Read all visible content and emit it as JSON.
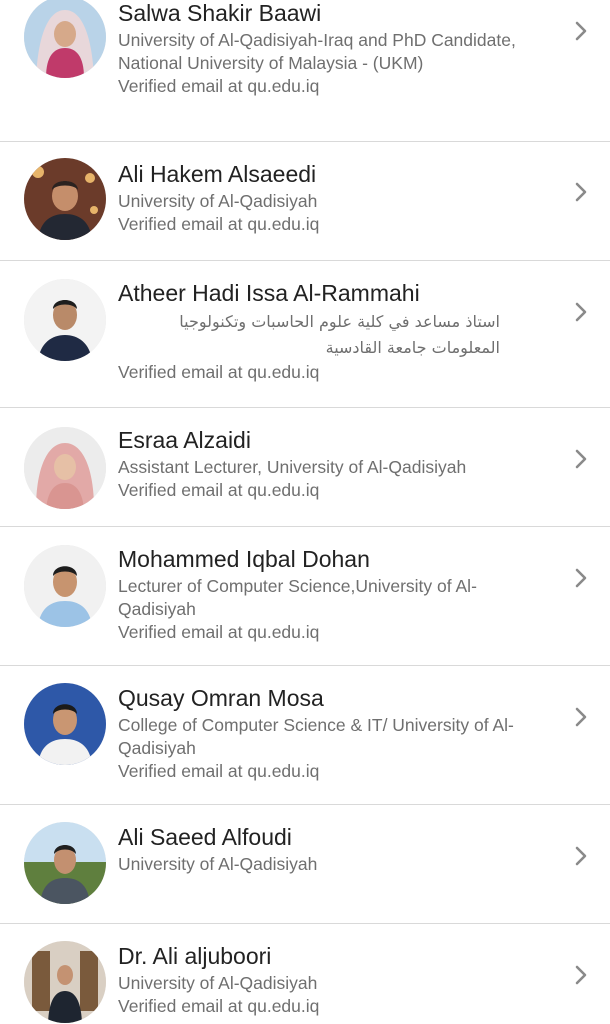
{
  "profiles": [
    {
      "name": "Salwa Shakir Baawi",
      "affiliation": "University of Al-Qadisiyah-Iraq and PhD Candidate, National University of Malaysia - (UKM)",
      "email": "Verified email at qu.edu.iq"
    },
    {
      "name": "Ali Hakem Alsaeedi",
      "affiliation": "University of Al-Qadisiyah",
      "email": "Verified email at qu.edu.iq"
    },
    {
      "name": "Atheer Hadi Issa Al-Rammahi",
      "affiliation": "استاذ مساعد في كلية علوم الحاسبات وتكنولوجيا المعلومات جامعة القادسية",
      "email": "Verified email at qu.edu.iq"
    },
    {
      "name": "Esraa Alzaidi",
      "affiliation": "Assistant Lecturer, University of Al-Qadisiyah",
      "email": "Verified email at qu.edu.iq"
    },
    {
      "name": "Mohammed Iqbal Dohan",
      "affiliation": "Lecturer of Computer Science,University of Al-Qadisiyah",
      "email": "Verified email at qu.edu.iq"
    },
    {
      "name": "Qusay Omran Mosa",
      "affiliation": "College of Computer Science & IT/ University of Al-Qadisiyah",
      "email": "Verified email at qu.edu.iq"
    },
    {
      "name": "Ali Saeed Alfoudi",
      "affiliation": "University of Al-Qadisiyah",
      "email": ""
    },
    {
      "name": "Dr. Ali aljuboori",
      "affiliation": "University of Al-Qadisiyah",
      "email": "Verified email at qu.edu.iq"
    }
  ],
  "icons": {
    "avatar": "profile-photo",
    "row_action": "chevron-right-icon"
  },
  "colors": {
    "name": "#222222",
    "secondary": "#6f6f6f",
    "divider": "#d9d9d9",
    "chevron": "#8a8a8a"
  }
}
